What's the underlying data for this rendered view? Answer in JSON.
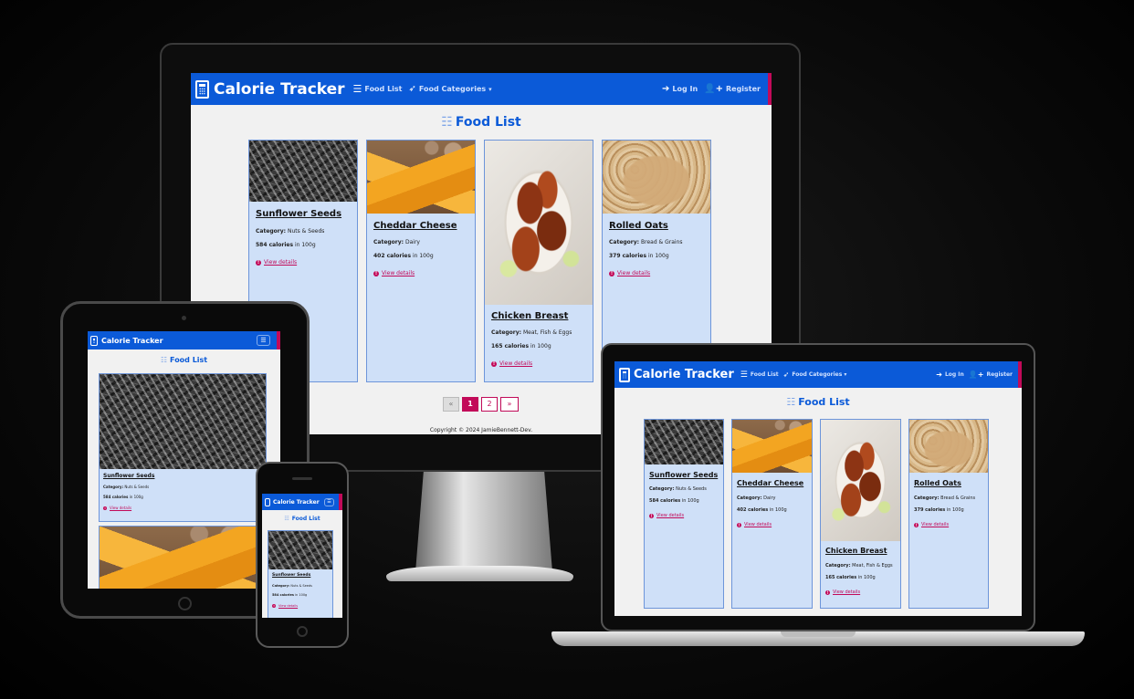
{
  "app": {
    "brand": "Calorie Tracker",
    "nav": {
      "food_list": "Food List",
      "food_categories": "Food Categories",
      "log_in": "Log In",
      "register": "Register"
    },
    "page_title": "Food List",
    "footer": "Copyright © 2024 JamieBennett-Dev.",
    "pagination": {
      "prev": "«",
      "pages": [
        "1",
        "2"
      ],
      "current": "1",
      "next": "»"
    }
  },
  "foods": [
    {
      "name": "Sunflower Seeds",
      "category_label": "Category:",
      "category": "Nuts & Seeds",
      "calories": "584 calories",
      "per": "in 100g",
      "link": "View details",
      "image": "sunflower-seeds"
    },
    {
      "name": "Cheddar Cheese",
      "category_label": "Category:",
      "category": "Dairy",
      "calories": "402 calories",
      "per": "in 100g",
      "link": "View details",
      "image": "cheddar-cheese"
    },
    {
      "name": "Chicken Breast",
      "category_label": "Category:",
      "category": "Meat, Fish & Eggs",
      "calories": "165 calories",
      "per": "in 100g",
      "link": "View details",
      "image": "chicken-breast"
    },
    {
      "name": "Rolled Oats",
      "category_label": "Category:",
      "category": "Bread & Grains",
      "calories": "379 calories",
      "per": "in 100g",
      "link": "View details",
      "image": "rolled-oats"
    }
  ],
  "colors": {
    "navbar": "#0b5ad8",
    "accent": "#c20a59",
    "card_bg": "#cfe0f8",
    "page_bg": "#f1f1f1"
  }
}
